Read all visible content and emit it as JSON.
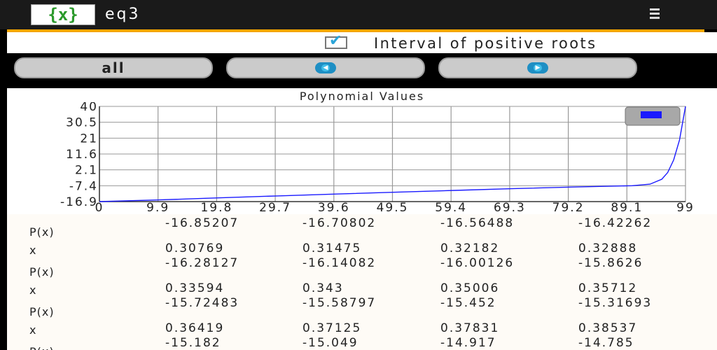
{
  "app": {
    "title": "eq3",
    "logo_glyph": "{x}"
  },
  "checkbox": {
    "label": "Interval of positive roots",
    "checked": true
  },
  "buttons": {
    "all_label": "all",
    "prev_icon": "left-arrow-icon",
    "next_icon": "right-arrow-icon"
  },
  "chart_data": {
    "type": "line",
    "title": "Polynomial Values",
    "xlabel": "",
    "ylabel": "",
    "x_ticks": [
      "0",
      "9.9",
      "19.8",
      "29.7",
      "39.6",
      "49.5",
      "59.4",
      "69.3",
      "79.2",
      "89.1",
      "99"
    ],
    "y_ticks": [
      "-16.9",
      "-7.4",
      "2.1",
      "11.6",
      "21",
      "30.5",
      "40"
    ],
    "xlim": [
      0,
      99
    ],
    "ylim": [
      -16.9,
      40
    ],
    "grid": true,
    "legend": "top-right",
    "series": [
      {
        "color": "#1a1aff",
        "x": [
          0,
          10,
          20,
          30,
          40,
          50,
          60,
          70,
          80,
          90,
          93,
          95,
          96,
          97,
          98,
          99
        ],
        "y": [
          -16.9,
          -15.9,
          -14.7,
          -13.5,
          -12.4,
          -11.3,
          -10.2,
          -9.1,
          -8.2,
          -7.4,
          -6.5,
          -3.5,
          0.5,
          8,
          20,
          40
        ]
      }
    ]
  },
  "table": {
    "rows": [
      {
        "label": "P(x)",
        "values": [
          "-16.85207",
          "-16.70802",
          "-16.56488",
          "-16.42262"
        ]
      },
      {
        "label": "x",
        "values": [
          "0.30769",
          "0.31475",
          "0.32182",
          "0.32888"
        ]
      },
      {
        "label": "P(x)",
        "values": [
          "-16.28127",
          "-16.14082",
          "-16.00126",
          "-15.8626"
        ]
      },
      {
        "label": "x",
        "values": [
          "0.33594",
          "0.343",
          "0.35006",
          "0.35712"
        ]
      },
      {
        "label": "P(x)",
        "values": [
          "-15.72483",
          "-15.58797",
          "-15.452",
          "-15.31693"
        ]
      },
      {
        "label": "x",
        "values": [
          "0.36419",
          "0.37125",
          "0.37831",
          "0.38537"
        ]
      },
      {
        "label": "P(x)",
        "values": [
          "-15.182",
          "-15.049",
          "-14.917",
          "-14.785"
        ]
      }
    ]
  }
}
